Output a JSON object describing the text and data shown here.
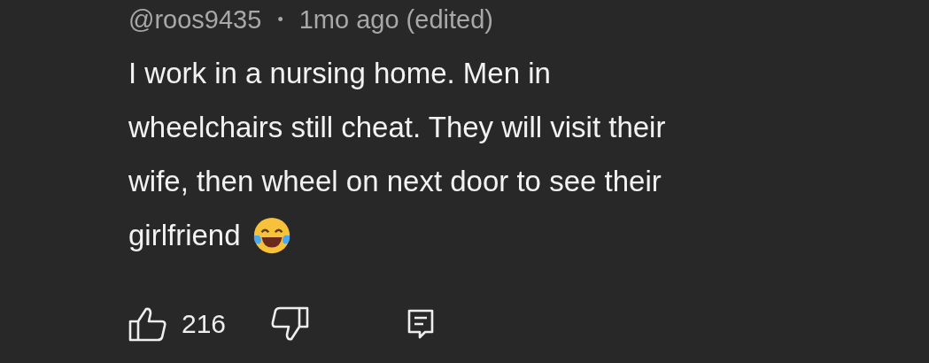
{
  "comment": {
    "author": "@roos9435",
    "separator": "•",
    "time": "1mo ago (edited)",
    "body_lines": [
      "I work in a nursing home. Men in",
      "wheelchairs still cheat. They will visit their",
      "wife, then wheel on next door to see their",
      "girlfriend"
    ],
    "likes": "216"
  }
}
